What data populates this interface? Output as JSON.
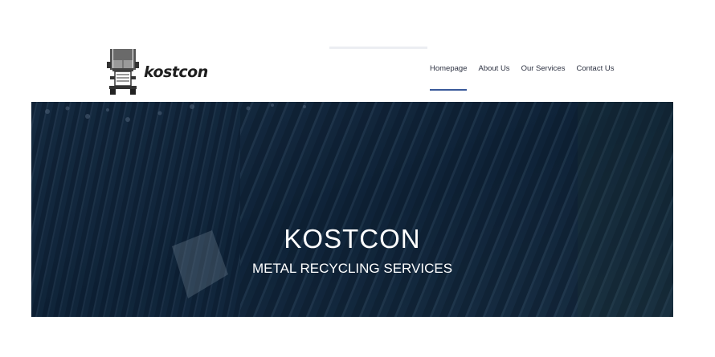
{
  "brand": {
    "logo_text": "kostcon",
    "logo_icon": "truck-icon"
  },
  "nav": {
    "items": [
      {
        "label": "Homepage",
        "active": true
      },
      {
        "label": "About Us",
        "active": false
      },
      {
        "label": "Our Services",
        "active": false
      },
      {
        "label": "Contact Us",
        "active": false
      }
    ]
  },
  "hero": {
    "title": "KOSTCON",
    "subtitle": "METAL RECYCLING SERVICES"
  },
  "colors": {
    "nav_active_underline": "#3a5a9a",
    "hero_overlay": "#0d1f33",
    "text_dark": "#2b3040"
  }
}
